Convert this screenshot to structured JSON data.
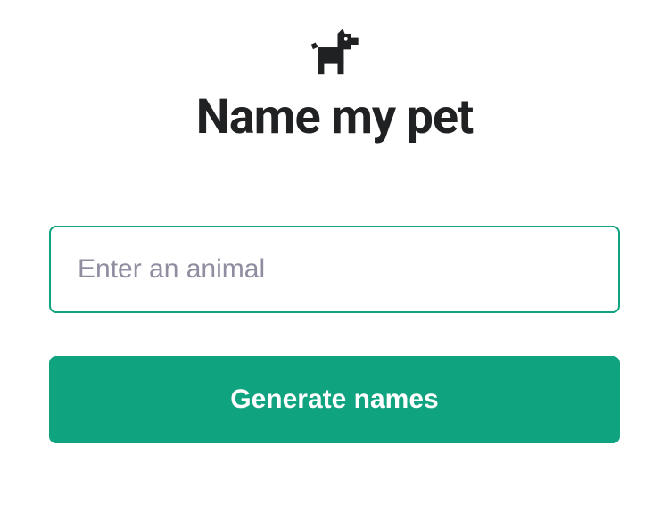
{
  "header": {
    "icon_name": "dog-icon",
    "title": "Name my pet"
  },
  "form": {
    "animal_input": {
      "placeholder": "Enter an animal",
      "value": ""
    },
    "submit_label": "Generate names"
  },
  "colors": {
    "accent": "#10a37f",
    "text_dark": "#202123",
    "placeholder": "#8e8ea0"
  }
}
